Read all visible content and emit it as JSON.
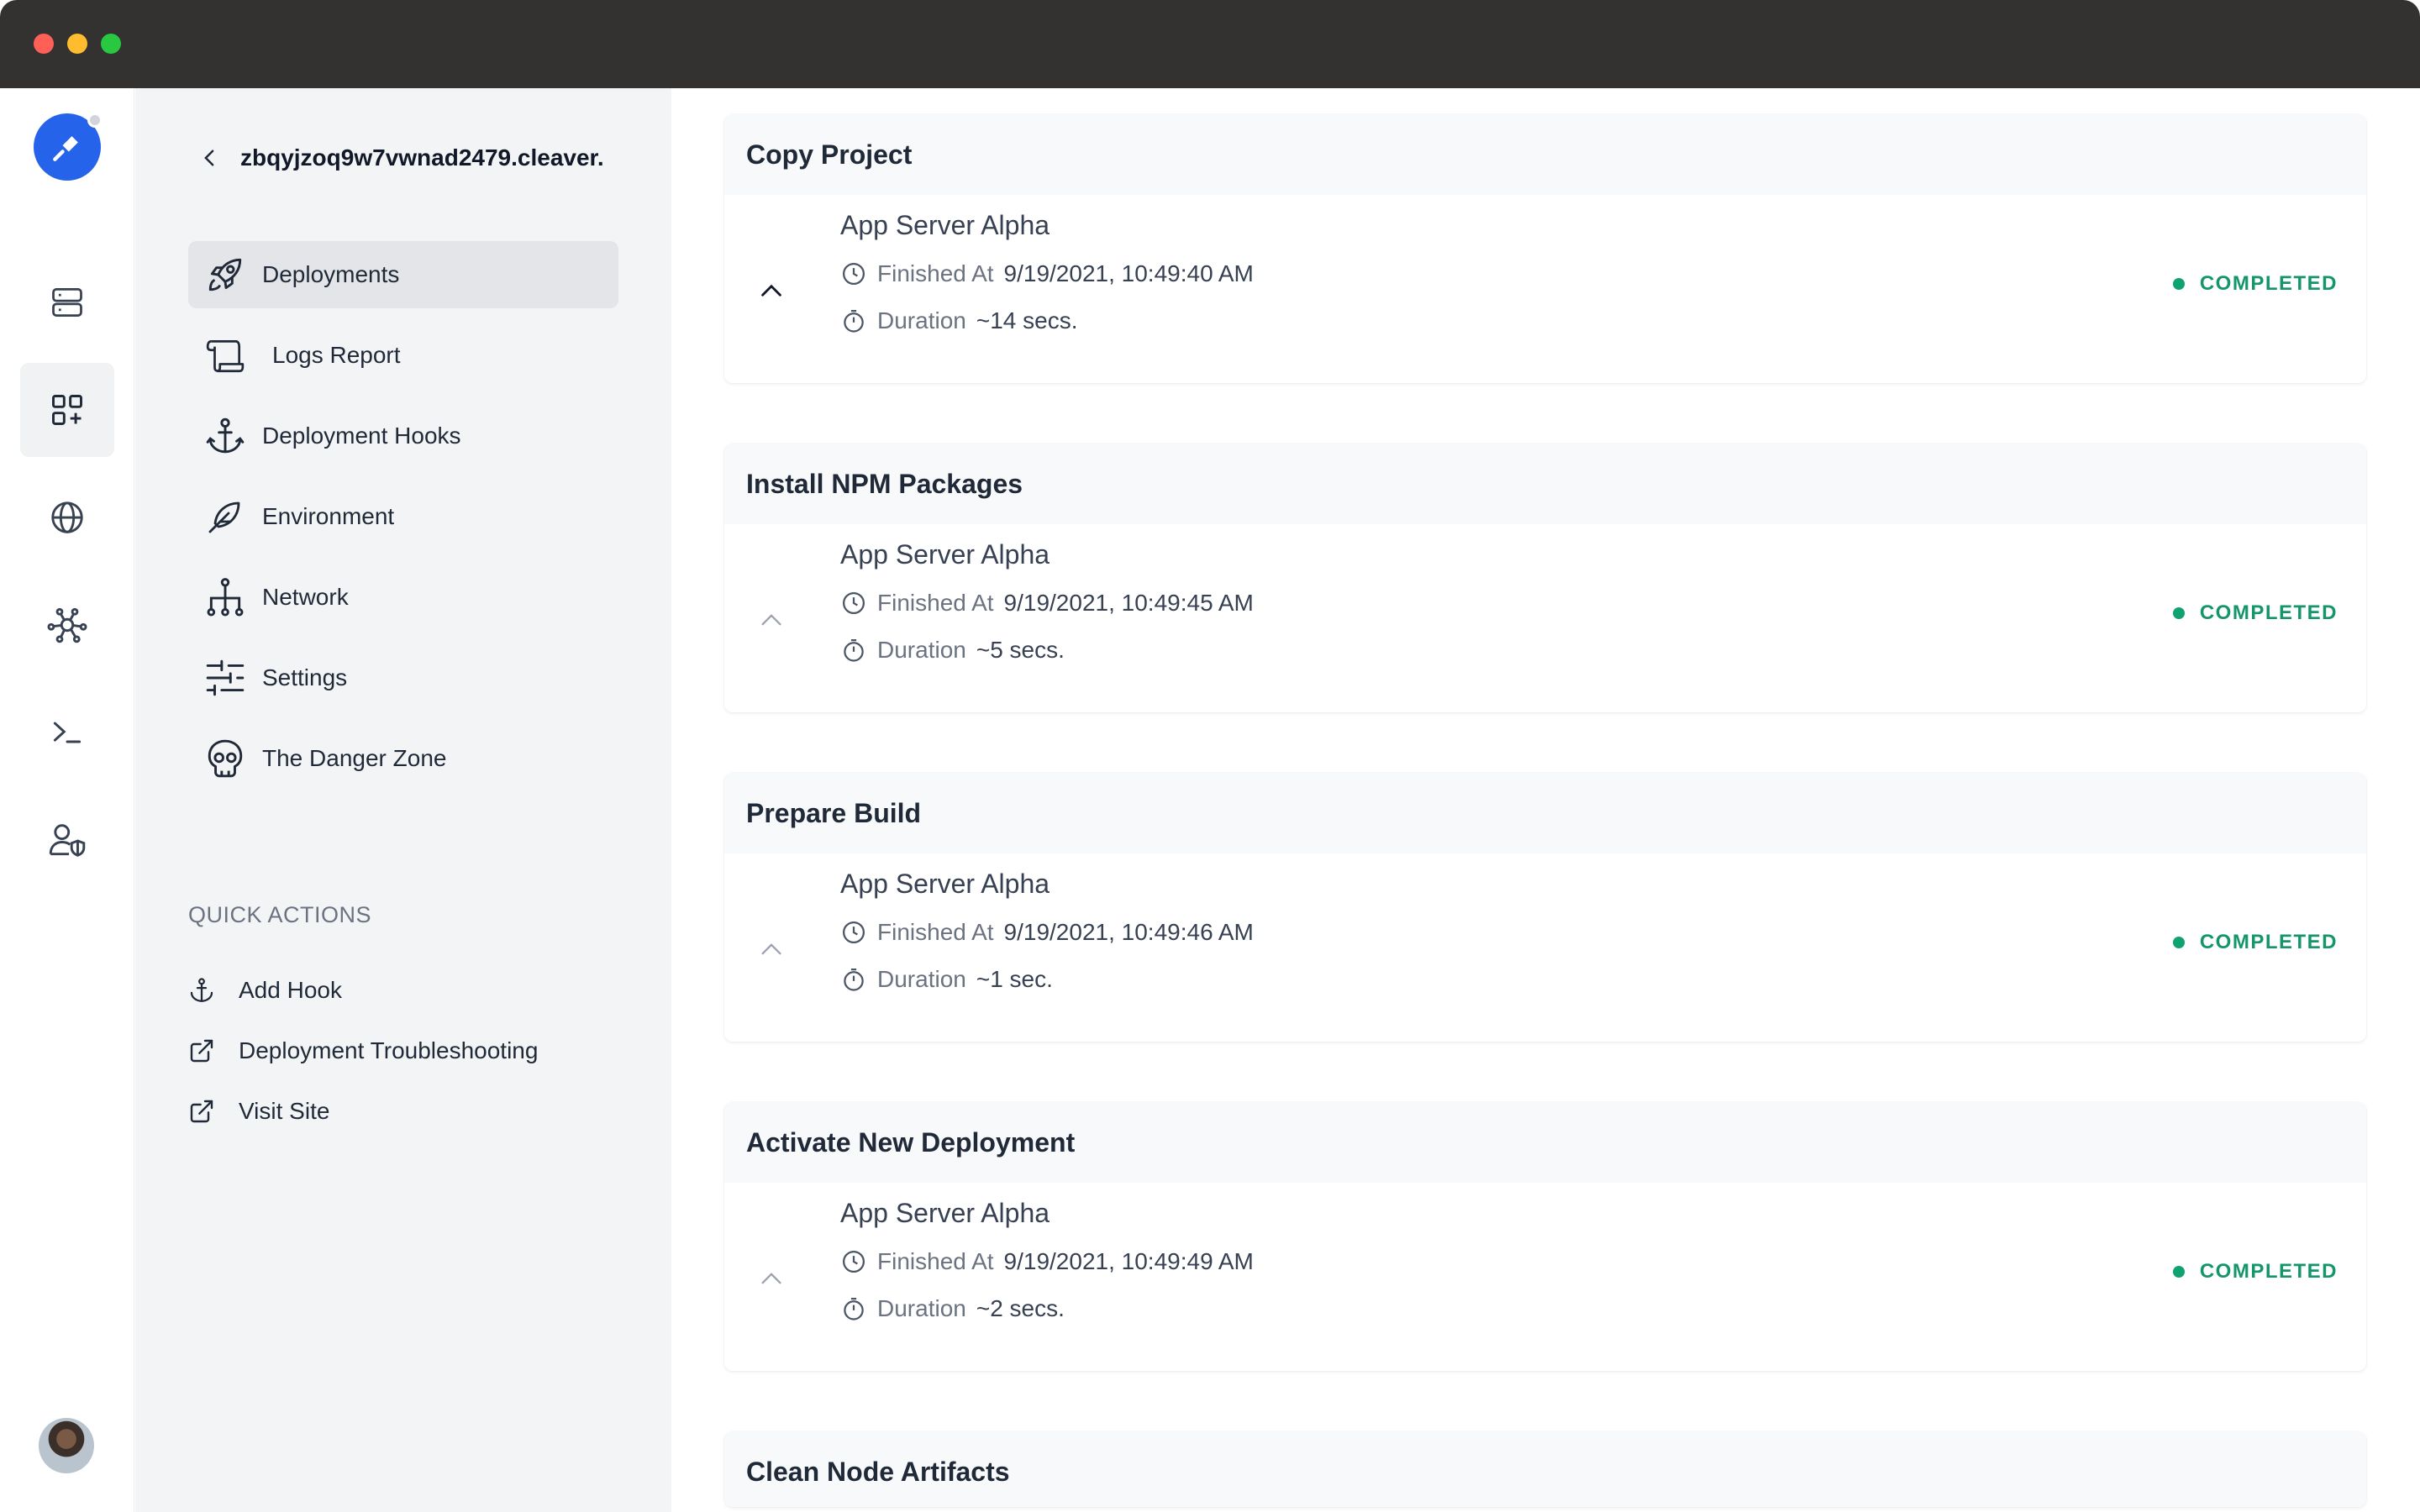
{
  "window": {
    "controls": [
      "close",
      "minimize",
      "maximize"
    ]
  },
  "rail": {
    "items": [
      {
        "icon": "server-icon",
        "active": false
      },
      {
        "icon": "apps-add-icon",
        "active": true
      },
      {
        "icon": "globe-icon",
        "active": false
      },
      {
        "icon": "network-nodes-icon",
        "active": false
      },
      {
        "icon": "terminal-icon",
        "active": false
      },
      {
        "icon": "user-shield-icon",
        "active": false
      }
    ]
  },
  "sidebar": {
    "project_name": "zbqyjzoq9w7vwnad2479.cleaver.",
    "items": [
      {
        "label": "Deployments",
        "icon": "rocket-icon",
        "active": true
      },
      {
        "label": "Logs Report",
        "icon": "scroll-icon",
        "active": false
      },
      {
        "label": "Deployment Hooks",
        "icon": "anchor-icon",
        "active": false
      },
      {
        "label": "Environment",
        "icon": "feather-icon",
        "active": false
      },
      {
        "label": "Network",
        "icon": "sitemap-icon",
        "active": false
      },
      {
        "label": "Settings",
        "icon": "sliders-icon",
        "active": false
      },
      {
        "label": "The Danger Zone",
        "icon": "skull-icon",
        "active": false
      }
    ],
    "quick_actions_title": "QUICK ACTIONS",
    "quick_actions": [
      {
        "label": "Add Hook",
        "icon": "anchor-icon"
      },
      {
        "label": "Deployment Troubleshooting",
        "icon": "external-link-icon"
      },
      {
        "label": "Visit Site",
        "icon": "external-link-icon"
      }
    ]
  },
  "steps": [
    {
      "title": "Copy Project",
      "server": "App Server Alpha",
      "finished_label": "Finished At",
      "finished_at": "9/19/2021, 10:49:40 AM",
      "duration_label": "Duration",
      "duration": "~14 secs.",
      "status": "COMPLETED"
    },
    {
      "title": "Install NPM Packages",
      "server": "App Server Alpha",
      "finished_label": "Finished At",
      "finished_at": "9/19/2021, 10:49:45 AM",
      "duration_label": "Duration",
      "duration": "~5 secs.",
      "status": "COMPLETED"
    },
    {
      "title": "Prepare Build",
      "server": "App Server Alpha",
      "finished_label": "Finished At",
      "finished_at": "9/19/2021, 10:49:46 AM",
      "duration_label": "Duration",
      "duration": "~1 sec.",
      "status": "COMPLETED"
    },
    {
      "title": "Activate New Deployment",
      "server": "App Server Alpha",
      "finished_label": "Finished At",
      "finished_at": "9/19/2021, 10:49:49 AM",
      "duration_label": "Duration",
      "duration": "~2 secs.",
      "status": "COMPLETED"
    },
    {
      "title": "Clean Node Artifacts"
    }
  ],
  "colors": {
    "accent": "#2563eb",
    "status_completed": "#15966a",
    "titlebar": "#333230"
  }
}
